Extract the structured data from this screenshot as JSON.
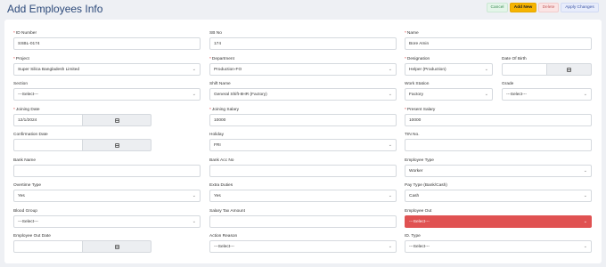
{
  "header": {
    "title": "Add Employees Info",
    "buttons": {
      "cancel": "Cancel",
      "add": "Add New",
      "delete": "Delete",
      "apply": "Apply Changes"
    }
  },
  "form": {
    "id_number": {
      "label": "ID Number",
      "value": "SSBL-0174"
    },
    "sb_no": {
      "label": "SB No",
      "value": "174"
    },
    "name": {
      "label": "Name",
      "value": "Bore Amin"
    },
    "project": {
      "label": "Project",
      "value": "Super Silica Bangladesh Limited"
    },
    "department": {
      "label": "Department",
      "value": "Production-FO"
    },
    "designation": {
      "label": "Designation",
      "value": "Helper (Production)"
    },
    "date_of_birth": {
      "label": "Date Of Birth",
      "value": ""
    },
    "section": {
      "label": "Section",
      "value": "---Select---"
    },
    "shift_name": {
      "label": "Shift Name",
      "value": "General Shift-8HR (Factory)"
    },
    "work_station": {
      "label": "Work Station",
      "value": "Factory"
    },
    "grade": {
      "label": "Grade",
      "value": "---Select---"
    },
    "joining_date": {
      "label": "Joining Date",
      "value": "12/1/2024"
    },
    "joining_salary": {
      "label": "Joining Salary",
      "value": "10000"
    },
    "present_salary": {
      "label": "Present Salary",
      "value": "10000"
    },
    "confirmation_date": {
      "label": "Confirmation Date",
      "value": ""
    },
    "holiday": {
      "label": "Holiday",
      "value": "FRI"
    },
    "tin_no": {
      "label": "TIN No.",
      "value": ""
    },
    "bank_name": {
      "label": "Bank Name",
      "value": ""
    },
    "bank_acc_no": {
      "label": "Bank Acc No",
      "value": ""
    },
    "employee_type": {
      "label": "Employee Type",
      "value": "Worker"
    },
    "overtime_type": {
      "label": "Overtime Type",
      "value": "Yes"
    },
    "extra_duties": {
      "label": "Extra Duties",
      "value": "Yes"
    },
    "pay_type": {
      "label": "Pay Type (Bank/Cash)",
      "value": "Cash"
    },
    "blood_group": {
      "label": "Blood Group",
      "value": "---Select---"
    },
    "salary_tax_amount": {
      "label": "Salary Tax Amount",
      "value": ""
    },
    "employee_out": {
      "label": "Employee Out",
      "value": "---Select---"
    },
    "employee_out_date": {
      "label": "Employee Out Date",
      "value": ""
    },
    "action_reason": {
      "label": "Action Reason",
      "value": "---Select---"
    },
    "id_type": {
      "label": "ID. Type",
      "value": "---Select---"
    }
  },
  "colors": {
    "accent": "#f6b400",
    "title": "#2d4a7a",
    "error": "#e05252"
  },
  "icons": {
    "calendar": "calendar-icon",
    "dropdown": "chevron-down-icon"
  }
}
